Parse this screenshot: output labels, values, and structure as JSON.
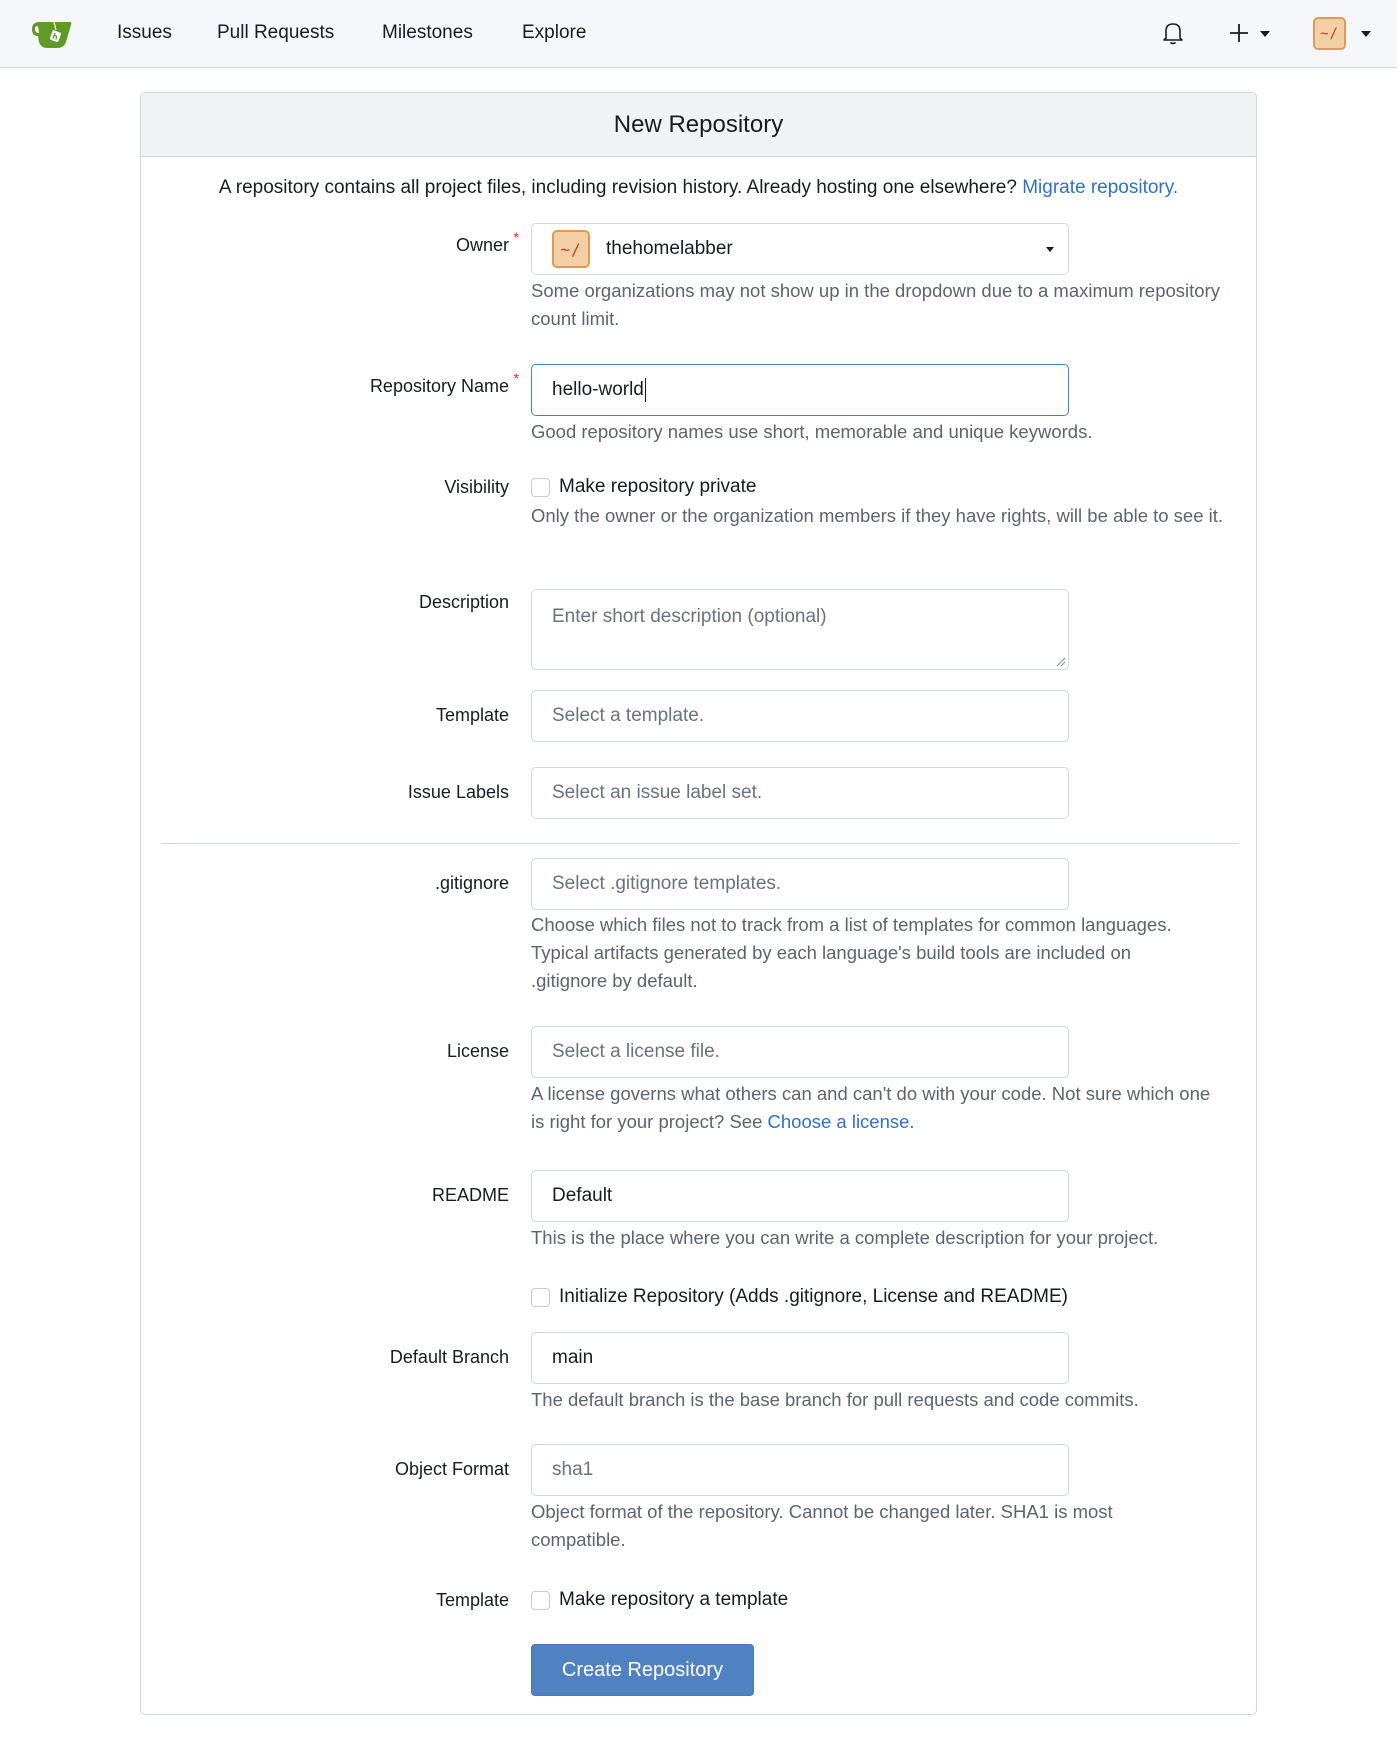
{
  "navbar": {
    "logo": "gitea-teacup-logo",
    "links": [
      {
        "label": "Issues"
      },
      {
        "label": "Pull Requests"
      },
      {
        "label": "Milestones"
      },
      {
        "label": "Explore"
      }
    ],
    "icons": {
      "notifications": "bell-icon",
      "create": "plus-icon",
      "user_menu": "avatar"
    },
    "avatar_text": "~/"
  },
  "page": {
    "title": "New Repository",
    "intro_text": "A repository contains all project files, including revision history. Already hosting one elsewhere?",
    "intro_link": "Migrate repository."
  },
  "form": {
    "owner": {
      "label": "Owner",
      "required": true,
      "value": "thehomelabber",
      "avatar_text": "~/",
      "help": "Some organizations may not show up in the dropdown due to a maximum repository count limit."
    },
    "repo_name": {
      "label": "Repository Name",
      "required": true,
      "value": "hello-world",
      "help": "Good repository names use short, memorable and unique keywords."
    },
    "visibility": {
      "label": "Visibility",
      "checkbox_label": "Make repository private",
      "checked": false,
      "help": "Only the owner or the organization members if they have rights, will be able to see it."
    },
    "description": {
      "label": "Description",
      "placeholder": "Enter short description (optional)",
      "value": ""
    },
    "template": {
      "label": "Template",
      "placeholder": "Select a template."
    },
    "issue_labels": {
      "label": "Issue Labels",
      "placeholder": "Select an issue label set."
    },
    "gitignore": {
      "label": ".gitignore",
      "placeholder": "Select .gitignore templates.",
      "help": "Choose which files not to track from a list of templates for common languages. Typical artifacts generated by each language's build tools are included on .gitignore by default."
    },
    "license": {
      "label": "License",
      "placeholder": "Select a license file.",
      "help": "A license governs what others can and can't do with your code. Not sure which one is right for your project? See",
      "help_link": "Choose a license."
    },
    "readme": {
      "label": "README",
      "value": "Default",
      "help": "This is the place where you can write a complete description for your project."
    },
    "init_repo": {
      "checkbox_label": "Initialize Repository (Adds .gitignore, License and README)",
      "checked": false
    },
    "default_branch": {
      "label": "Default Branch",
      "value": "main",
      "help": "The default branch is the base branch for pull requests and code commits."
    },
    "object_format": {
      "label": "Object Format",
      "value": "sha1",
      "help": "Object format of the repository. Cannot be changed later. SHA1 is most compatible."
    },
    "template_flag": {
      "label": "Template",
      "checkbox_label": "Make repository a template",
      "checked": false
    },
    "submit_label": "Create Repository"
  },
  "colors": {
    "brand_green": "#609926",
    "primary_button": "#5081c0",
    "link": "#2f71c7",
    "required": "#db2828",
    "avatar_bg": "#f3cfa6",
    "avatar_border": "#e39a4f",
    "avatar_text": "#c2411f"
  }
}
